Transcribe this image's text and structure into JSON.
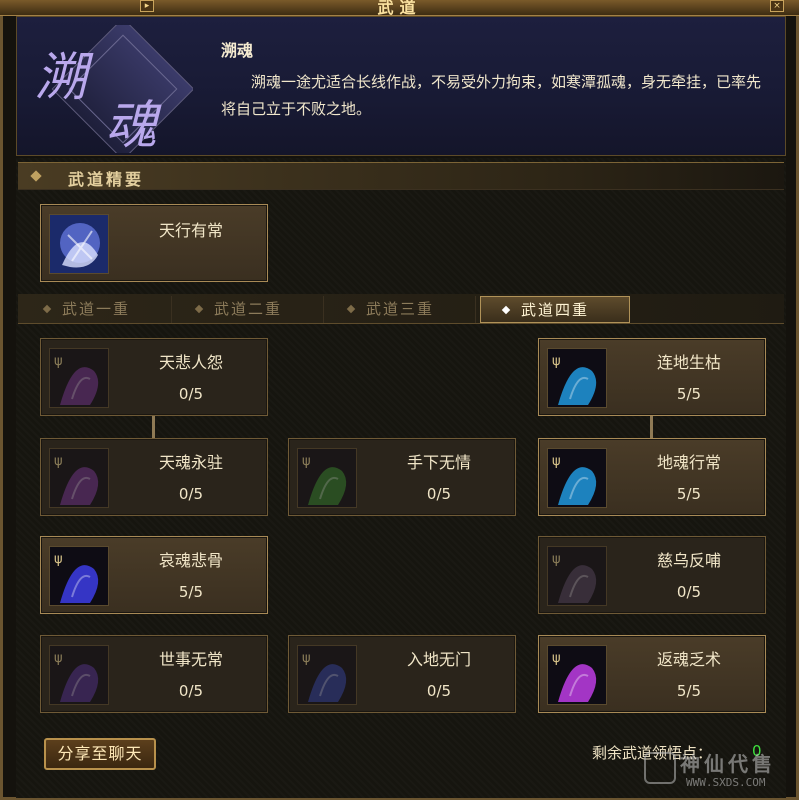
{
  "window": {
    "title": "武道",
    "sys_left": "▸",
    "sys_right": "×"
  },
  "header": {
    "emblem_text": "溯魂",
    "sect_name": "溯魂",
    "description": "溯魂一途尤适合长线作战，不易受外力拘束，如寒潭孤魂，身无牵挂，已率先将自己立于不败之地。"
  },
  "essentials": {
    "title": "武道精要",
    "skill": {
      "name": "天行有常",
      "icon": "spirit-fist-icon"
    }
  },
  "tabs": [
    {
      "label": "武道一重",
      "active": false
    },
    {
      "label": "武道二重",
      "active": false
    },
    {
      "label": "武道三重",
      "active": false
    },
    {
      "label": "武道四重",
      "active": true
    }
  ],
  "skills": [
    {
      "name": "天悲人怨",
      "level": "0/5",
      "icon": "purple-spirit-icon",
      "tone": "#6a2d8a",
      "learned": false
    },
    {
      "name": "连地生枯",
      "level": "5/5",
      "icon": "blue-spirit-icon",
      "tone": "#1f8fd0",
      "learned": true
    },
    {
      "name": "天魂永驻",
      "level": "0/5",
      "icon": "purple-spirit-icon",
      "tone": "#6a2d8a",
      "learned": false
    },
    {
      "name": "手下无情",
      "level": "0/5",
      "icon": "green-spirit-icon",
      "tone": "#2d7a2a",
      "learned": false
    },
    {
      "name": "地魂行常",
      "level": "5/5",
      "icon": "blue-spirit-icon",
      "tone": "#1f8fd0",
      "learned": true
    },
    {
      "name": "哀魂悲骨",
      "level": "5/5",
      "icon": "blue-flame-icon",
      "tone": "#3a3ad8",
      "learned": true
    },
    {
      "name": "慈乌反哺",
      "level": "0/5",
      "icon": "crow-icon",
      "tone": "#4a3c5a",
      "learned": false
    },
    {
      "name": "世事无常",
      "level": "0/5",
      "icon": "purple-beast-icon",
      "tone": "#4a2a8a",
      "learned": false
    },
    {
      "name": "入地无门",
      "level": "0/5",
      "icon": "blue-wave-icon",
      "tone": "#2a3a9a",
      "learned": false
    },
    {
      "name": "返魂乏术",
      "level": "5/5",
      "icon": "violet-spirit-icon",
      "tone": "#b43ad8",
      "learned": true
    }
  ],
  "footer": {
    "share_label": "分享至聊天",
    "points_label": "剩余武道领悟点：",
    "points_value": "0"
  },
  "watermark": {
    "text": "神仙代售",
    "url": "WWW.SXDS.COM"
  }
}
